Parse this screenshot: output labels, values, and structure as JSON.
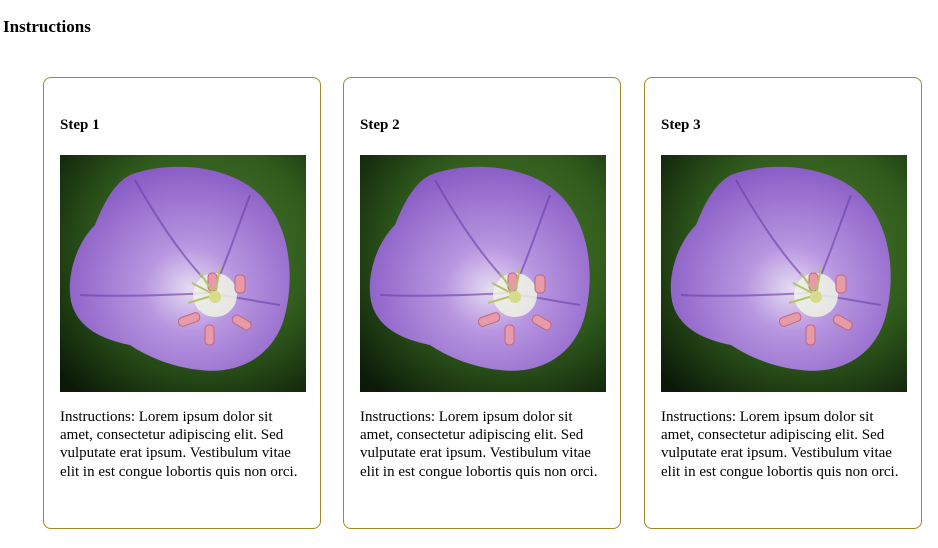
{
  "page": {
    "title": "Instructions"
  },
  "cards": [
    {
      "title": "Step 1",
      "text": "Instructions: Lorem ipsum dolor sit amet, consectetur adipiscing elit. Sed vulputate erat ipsum. Vestibulum vitae elit in est congue lobortis quis non orci."
    },
    {
      "title": "Step 2",
      "text": "Instructions: Lorem ipsum dolor sit amet, consectetur adipiscing elit. Sed vulputate erat ipsum. Vestibulum vitae elit in est congue lobortis quis non orci."
    },
    {
      "title": "Step 3",
      "text": "Instructions: Lorem ipsum dolor sit amet, consectetur adipiscing elit. Sed vulputate erat ipsum. Vestibulum vitae elit in est congue lobortis quis non orci."
    }
  ],
  "colors": {
    "card_border": "#a3872a",
    "flower_petal": "#9a6fcf",
    "background_green": "#2f5a1c"
  }
}
